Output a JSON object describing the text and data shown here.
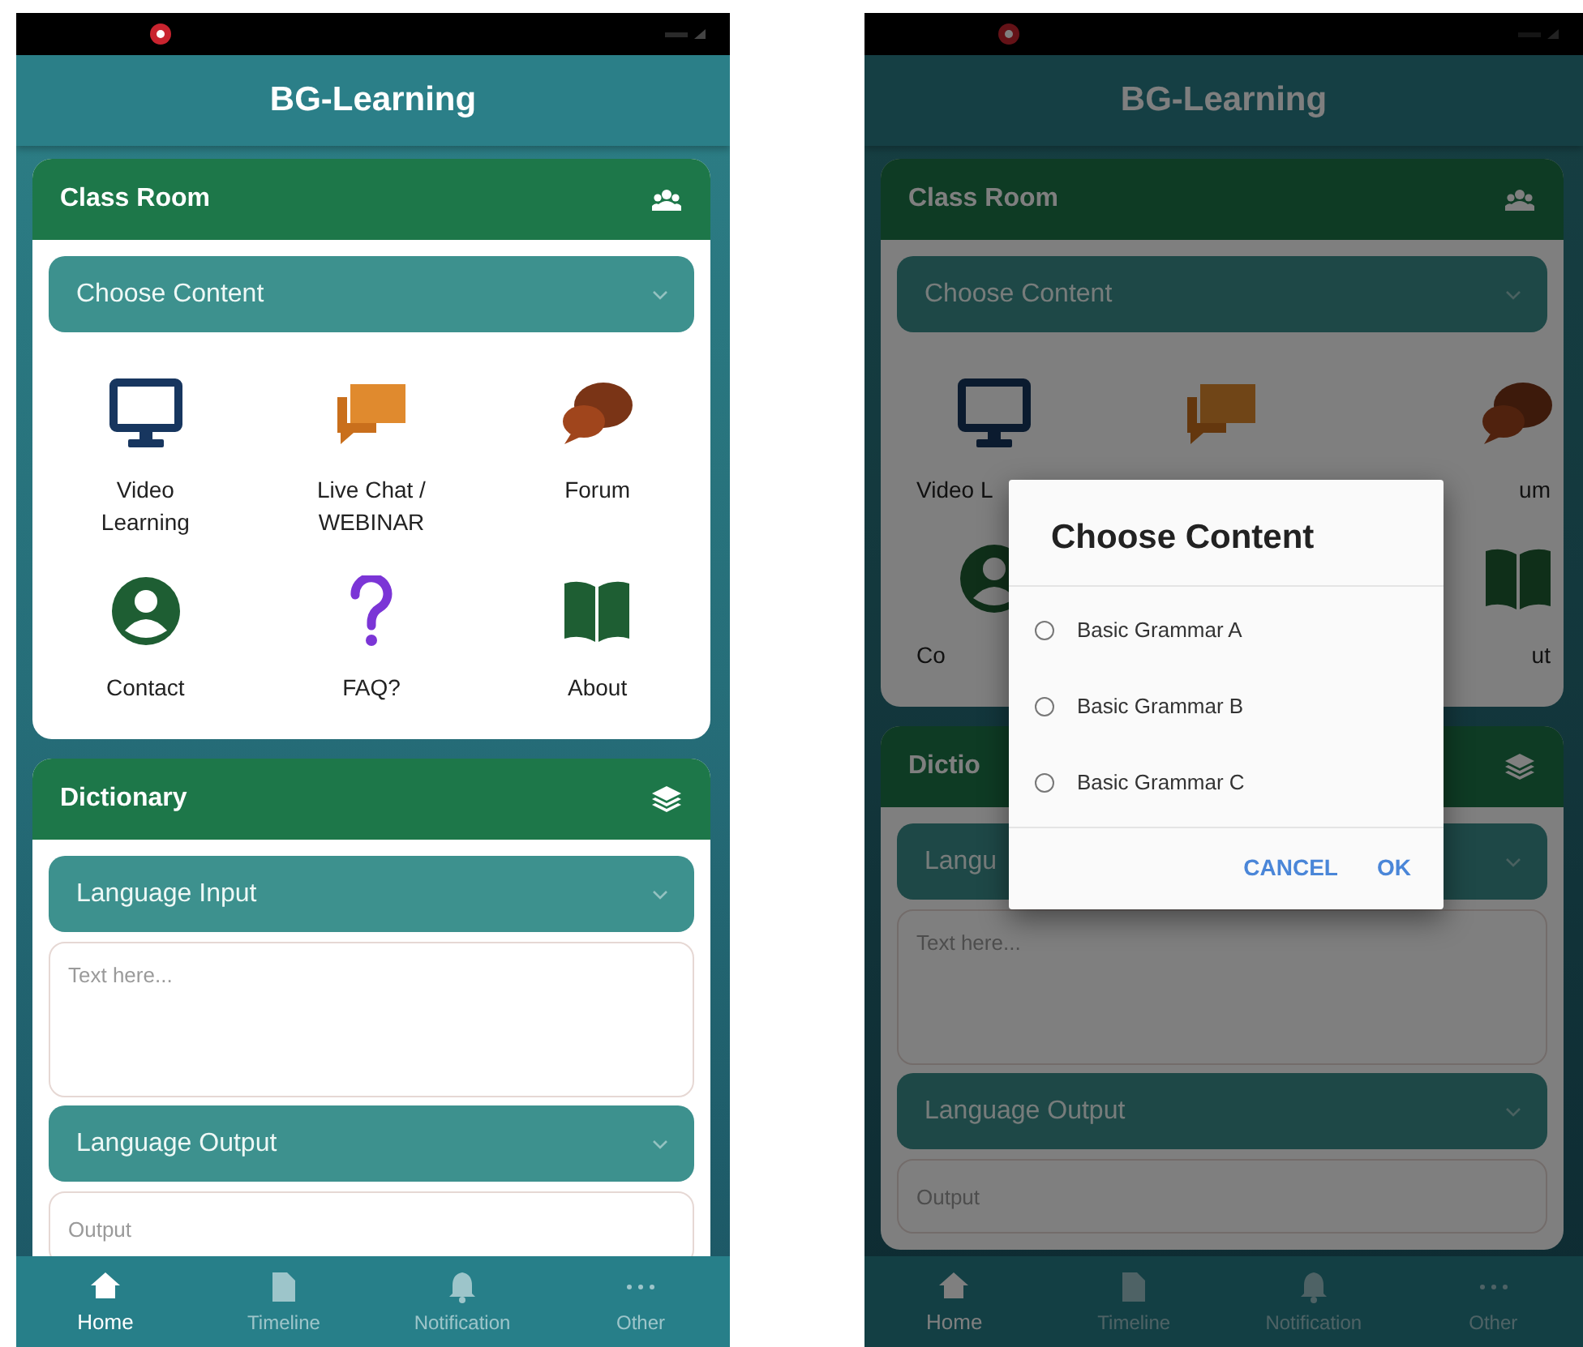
{
  "screens": [
    {
      "app_bar": {
        "title": "BG-Learning"
      },
      "classroom": {
        "title": "Class Room",
        "dropdown": {
          "label": "Choose Content"
        },
        "tile_rows": [
          [
            {
              "kind": "video",
              "label": "Video Learning"
            },
            {
              "kind": "chat",
              "label": "Live Chat / WEBINAR"
            },
            {
              "kind": "forum",
              "label": "Forum"
            }
          ],
          [
            {
              "kind": "contact",
              "label": "Contact"
            },
            {
              "kind": "faq",
              "label": "FAQ?"
            },
            {
              "kind": "about",
              "label": "About"
            }
          ]
        ]
      },
      "dictionary": {
        "title": "Dictionary",
        "input_dropdown": {
          "label": "Language Input"
        },
        "input_field": {
          "placeholder": "Text here..."
        },
        "output_dropdown": {
          "label": "Language Output"
        },
        "output_field": {
          "placeholder": "Output"
        }
      },
      "bottom_nav": [
        {
          "kind": "home",
          "label": "Home",
          "selected": true
        },
        {
          "kind": "timeline",
          "label": "Timeline",
          "selected": false
        },
        {
          "kind": "notification",
          "label": "Notification",
          "selected": false
        },
        {
          "kind": "other",
          "label": "Other",
          "selected": false
        }
      ]
    },
    {
      "app_bar": {
        "title": "BG-Learning"
      },
      "classroom": {
        "title": "Class Room",
        "dropdown": {
          "label": "Choose Content"
        },
        "tile_rows": [
          [
            {
              "kind": "video",
              "label": "Video L"
            },
            {
              "kind": "chat"
            },
            {
              "kind": "forum",
              "label": "um"
            }
          ],
          [
            {
              "kind": "contact",
              "label": "Co"
            },
            null,
            {
              "kind": "about",
              "label": "ut"
            }
          ]
        ]
      },
      "dictionary": {
        "title": "Dictio",
        "input_dropdown": {
          "label": "Langu"
        },
        "input_field": {
          "placeholder": "Text here..."
        },
        "output_dropdown": {
          "label": "Language Output"
        },
        "output_field": {
          "placeholder": "Output"
        }
      },
      "bottom_nav": [
        {
          "kind": "home",
          "label": "Home",
          "selected": true
        },
        {
          "kind": "timeline",
          "label": "Timeline",
          "selected": false
        },
        {
          "kind": "notification",
          "label": "Notification",
          "selected": false
        },
        {
          "kind": "other",
          "label": "Other",
          "selected": false
        }
      ],
      "dialog": {
        "title": "Choose Content",
        "options": [
          {
            "label": "Basic Grammar A",
            "selected": false
          },
          {
            "label": "Basic Grammar B",
            "selected": false
          },
          {
            "label": "Basic Grammar C",
            "selected": false
          }
        ],
        "buttons": [
          "CANCEL",
          "OK"
        ]
      }
    }
  ]
}
